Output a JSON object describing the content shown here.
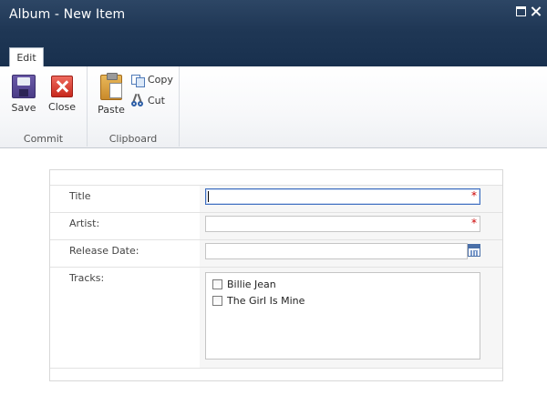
{
  "window": {
    "title": "Album - New Item"
  },
  "ribbon": {
    "tab": "Edit",
    "groups": {
      "commit": {
        "label": "Commit",
        "save_label": "Save",
        "close_label": "Close"
      },
      "clipboard": {
        "label": "Clipboard",
        "paste_label": "Paste",
        "copy_label": "Copy",
        "cut_label": "Cut"
      }
    }
  },
  "form": {
    "fields": {
      "title": {
        "label": "Title",
        "value": "",
        "required": "*"
      },
      "artist": {
        "label": "Artist:",
        "value": "",
        "required": "*"
      },
      "release_date": {
        "label": "Release Date:",
        "value": ""
      },
      "tracks": {
        "label": "Tracks:",
        "options": [
          {
            "label": "Billie Jean",
            "checked": false
          },
          {
            "label": "The Girl Is Mine",
            "checked": false
          }
        ]
      }
    }
  },
  "icons": {
    "save": "floppy-disk-icon",
    "close": "red-x-icon",
    "paste": "clipboard-icon",
    "copy": "copy-icon",
    "cut": "scissors-icon",
    "calendar": "calendar-icon"
  }
}
